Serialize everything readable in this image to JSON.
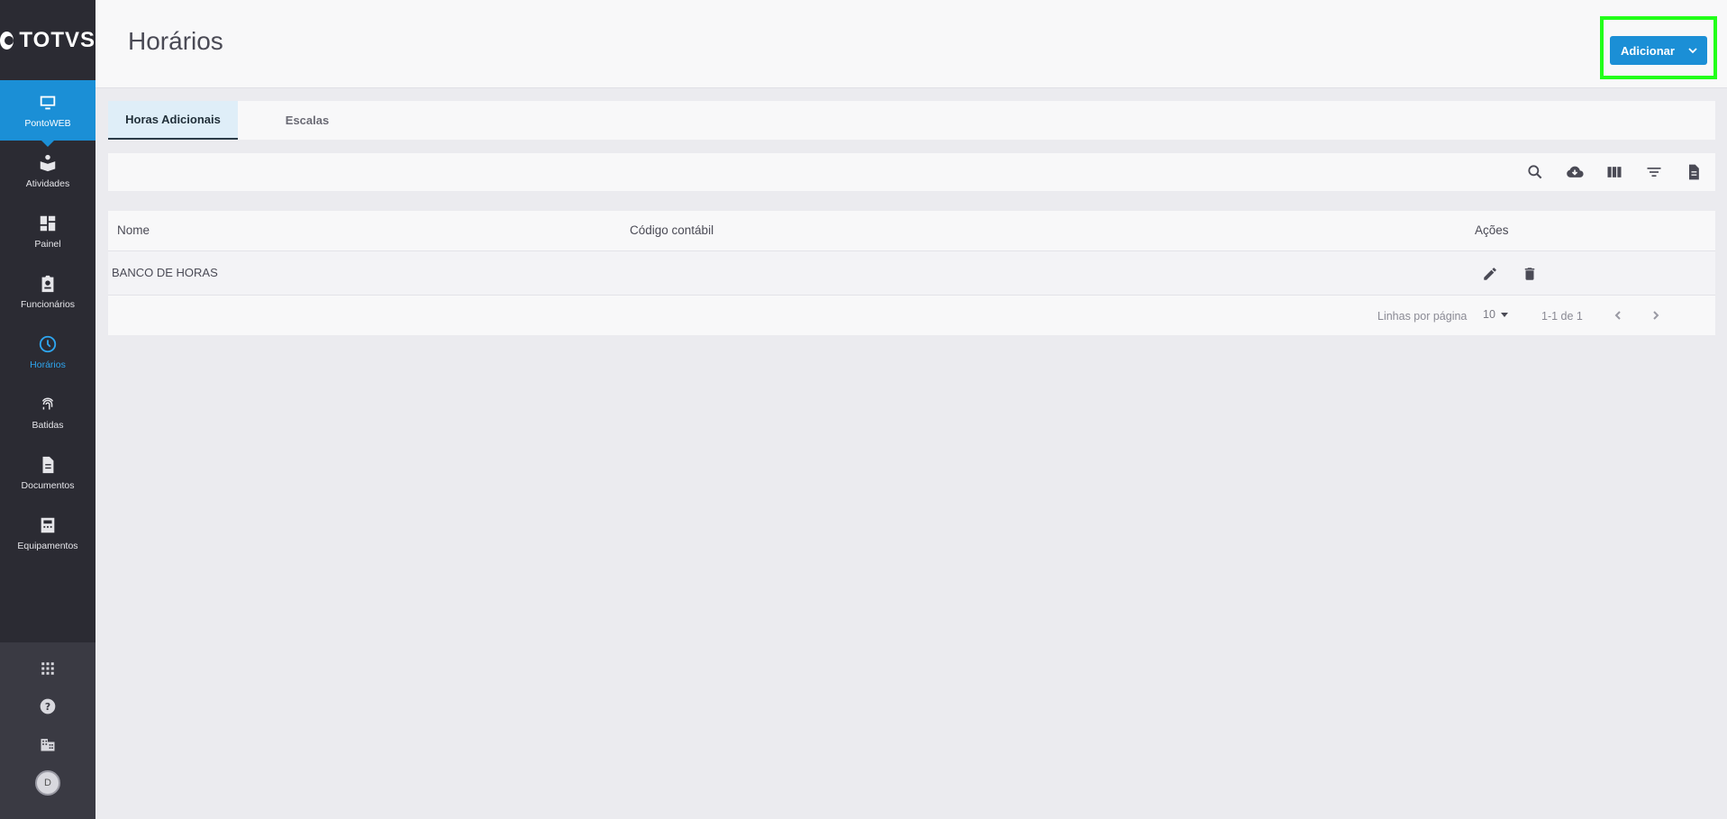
{
  "brand": {
    "logo_text": "TOTVS"
  },
  "sidebar": {
    "items": [
      {
        "label": "PontoWEB",
        "icon": "monitor-icon"
      },
      {
        "label": "Atividades",
        "icon": "book-user-icon"
      },
      {
        "label": "Painel",
        "icon": "dashboard-icon"
      },
      {
        "label": "Funcionários",
        "icon": "badge-icon"
      },
      {
        "label": "Horários",
        "icon": "clock-icon"
      },
      {
        "label": "Batidas",
        "icon": "fingerprint-icon"
      },
      {
        "label": "Documentos",
        "icon": "document-icon"
      },
      {
        "label": "Equipamentos",
        "icon": "equipment-icon"
      }
    ],
    "bottom": [
      {
        "icon": "apps-grid-icon"
      },
      {
        "icon": "help-icon"
      },
      {
        "icon": "company-icon"
      }
    ],
    "avatar_initial": "D"
  },
  "header": {
    "title": "Horários",
    "add_button_label": "Adicionar"
  },
  "tabs": [
    {
      "label": "Horas Adicionais",
      "active": true
    },
    {
      "label": "Escalas",
      "active": false
    }
  ],
  "toolbar": {
    "icons": [
      "search-icon",
      "cloud-download-icon",
      "columns-icon",
      "filter-icon",
      "report-icon"
    ]
  },
  "table": {
    "columns": [
      "Nome",
      "Código contábil",
      "Ações"
    ],
    "rows": [
      {
        "nome": "BANCO DE HORAS",
        "codigo": ""
      }
    ],
    "footer": {
      "rows_per_page_label": "Linhas por página",
      "rows_per_page_value": "10",
      "range_text": "1-1 de 1"
    }
  },
  "colors": {
    "accent": "#1b8fd6",
    "sidebar_bg": "#2b2b33",
    "highlight": "#22ff1a"
  }
}
